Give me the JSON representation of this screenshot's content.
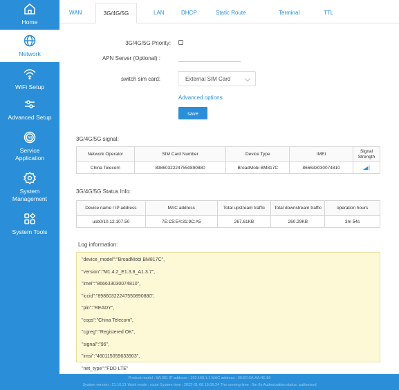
{
  "sidebar": {
    "items": [
      {
        "label": "Home",
        "icon": "home-icon"
      },
      {
        "label": "Network",
        "icon": "globe-icon"
      },
      {
        "label": "WiFi Setup",
        "icon": "wifi-icon"
      },
      {
        "label": "Advanced Setup",
        "icon": "sliders-icon"
      },
      {
        "label": "Service\nApplication",
        "icon": "service-icon"
      },
      {
        "label": "System\nManagement",
        "icon": "gear-icon"
      },
      {
        "label": "System Tools",
        "icon": "tools-grid-icon"
      }
    ],
    "active": "Network"
  },
  "tabs": {
    "items": [
      "WAN",
      "3G/4G/5G",
      "LAN",
      "DHCP",
      "Static Route",
      "Terminal",
      "TTL"
    ],
    "active": "3G/4G/5G"
  },
  "form": {
    "priority_label": "3G/4G/5G Priority:",
    "priority_checked": false,
    "apn_label": "APN Server (Optional) :",
    "apn_value": "",
    "sim_label": "switch sim card:",
    "sim_value": "External SIM Card",
    "advanced_link": "Advanced options",
    "save_label": "save"
  },
  "signal_section": {
    "title": "3G/4G/5G signal:",
    "headers": [
      "Network Operator",
      "SIM Card Number",
      "Device Type",
      "IMEI",
      "Signal Strength"
    ],
    "row": {
      "operator": "China Telecom",
      "sim": "89860322247550890880",
      "device": "BroadMobi BM817C",
      "imei": "866633030074810",
      "signal_icon": "signal-bars-icon"
    }
  },
  "status_section": {
    "title": "3G/4G/5G Status Info:",
    "headers": [
      "Device name / IP address",
      "MAC address",
      "Total upstream traffic",
      "Total downstream traffic",
      "operation hours"
    ],
    "row": {
      "device_ip": "usb0/10.12.107.50",
      "mac": "7E:C5:E4:31:9C:A5",
      "upstream": "267.61KB",
      "downstream": "260.29KB",
      "hours": "3m 54s"
    }
  },
  "log": {
    "title": "Log information:",
    "lines": [
      "\"device_model\":\"BroadMobi BM817C\",",
      "\"version\":\"M1.4.2_E1.3.8_A1.3.7\",",
      "\"imei\":\"866633030074810\",",
      "\"iccid\":\"89860322247550890880\",",
      "\"pin\":\"READY\",",
      "\"cops\":\"China Telecom\",",
      "\"cgreg\":\"Registered OK\",",
      "\"signal\":\"96\",",
      "\"imsi\":\"460115059633903\",",
      "\"net_type\":\"FDD LTE\""
    ]
  },
  "footer": {
    "line1": "Product model : WL381   IP address : 192.168.1.1   MAC address : 00:5D:5A:AA:4E:86",
    "line2": "System version : 21.10.21   Work mode : route   System time : 2022-01-08 15:06:24   The running time : 5m 8s   Authorization status: authorized"
  },
  "colors": {
    "accent": "#2a8fd8",
    "log_bg": "#fdf9d6"
  }
}
